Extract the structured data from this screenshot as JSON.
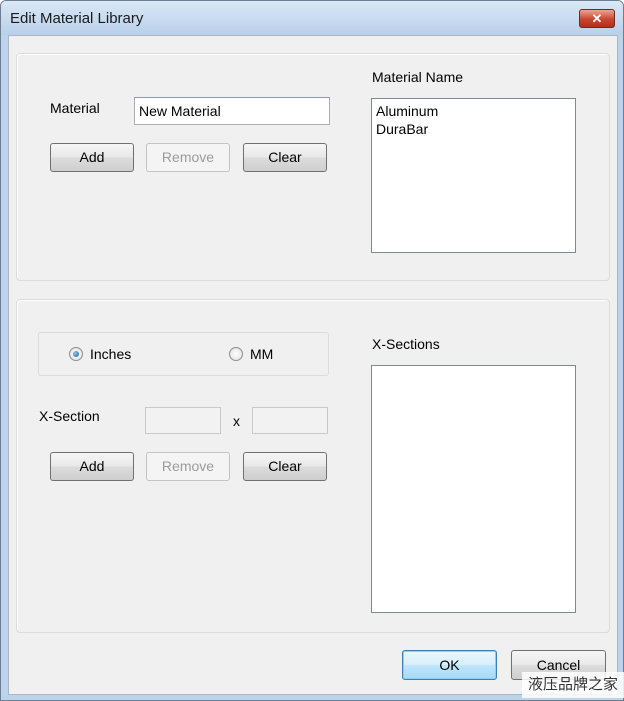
{
  "window": {
    "title": "Edit Material Library",
    "close_glyph": "✕"
  },
  "material_panel": {
    "material_label": "Material",
    "material_value": "New Material",
    "add_label": "Add",
    "remove_label": "Remove",
    "clear_label": "Clear",
    "list_header": "Material Name",
    "list_items": [
      "Aluminum",
      "DuraBar"
    ]
  },
  "section_panel": {
    "units": {
      "inches_label": "Inches",
      "mm_label": "MM",
      "selected": "Inches"
    },
    "xsection_label": "X-Section",
    "x_separator": "x",
    "width_value": "",
    "height_value": "",
    "add_label": "Add",
    "remove_label": "Remove",
    "clear_label": "Clear",
    "list_header": "X-Sections",
    "list_items": []
  },
  "footer": {
    "ok_label": "OK",
    "cancel_label": "Cancel"
  },
  "watermark": {
    "text": "液压品牌之家"
  },
  "colors": {
    "title_bar": "#bcd3ec",
    "dialog_bg": "#f0f0f0",
    "close_button": "#c8452f",
    "default_button_border": "#3c7fb1"
  }
}
